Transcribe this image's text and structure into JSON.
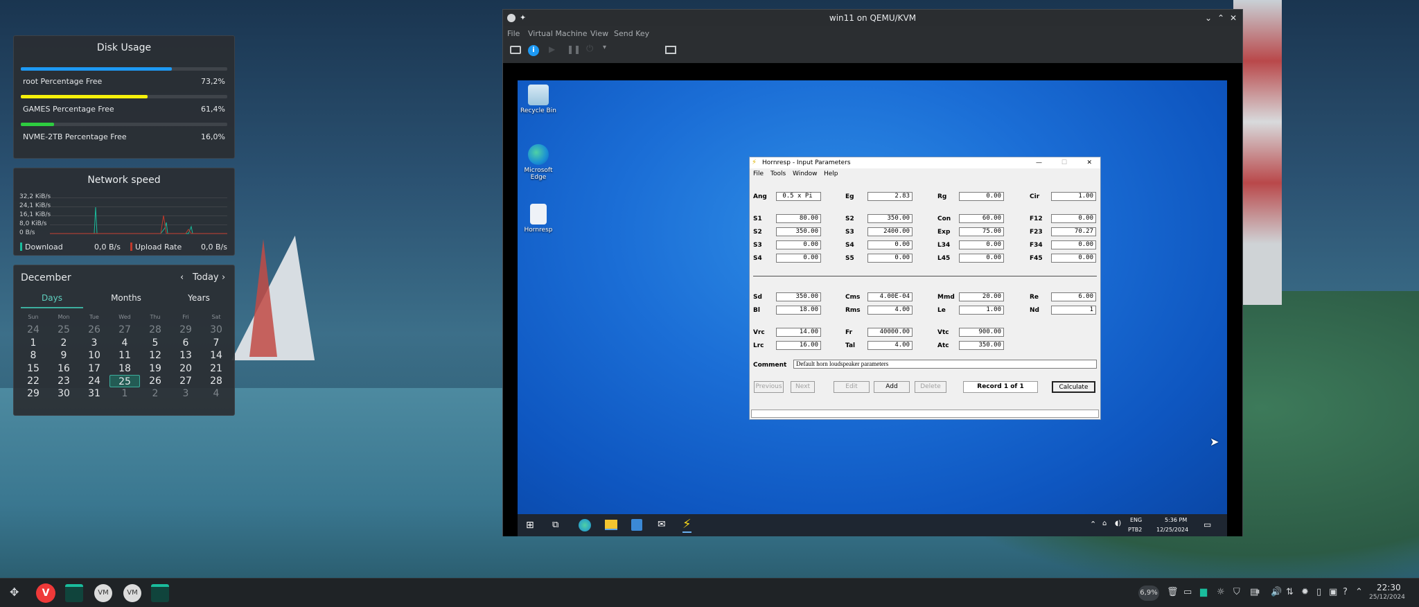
{
  "disk_usage": {
    "title": "Disk Usage",
    "items": [
      {
        "label": "root Percentage Free",
        "value": "73,2%",
        "fraction": 0.732,
        "color": "#1d99f3"
      },
      {
        "label": "GAMES Percentage Free",
        "value": "61,4%",
        "fraction": 0.614,
        "color": "#f6f10a"
      },
      {
        "label": "NVME-2TB Percentage Free",
        "value": "16,0%",
        "fraction": 0.16,
        "color": "#2ecc40"
      }
    ]
  },
  "network": {
    "title": "Network speed",
    "yticks": [
      "32,2 KiB/s",
      "24,1 KiB/s",
      "16,1 KiB/s",
      "8,0 KiB/s",
      "0 B/s"
    ],
    "download_label": "Download",
    "download_value": "0,0 B/s",
    "upload_label": "Upload Rate",
    "upload_value": "0,0 B/s",
    "download_color": "#1abc9c",
    "upload_color": "#c0392b"
  },
  "calendar": {
    "month": "December",
    "today_label": "Today",
    "tabs": [
      "Days",
      "Months",
      "Years"
    ],
    "weekdays": [
      "Sun",
      "Mon",
      "Tue",
      "Wed",
      "Thu",
      "Fri",
      "Sat"
    ],
    "days": [
      [
        "24",
        "25",
        "26",
        "27",
        "28",
        "29",
        "30"
      ],
      [
        "1",
        "2",
        "3",
        "4",
        "5",
        "6",
        "7"
      ],
      [
        "8",
        "9",
        "10",
        "11",
        "12",
        "13",
        "14"
      ],
      [
        "15",
        "16",
        "17",
        "18",
        "19",
        "20",
        "21"
      ],
      [
        "22",
        "23",
        "24",
        "25",
        "26",
        "27",
        "28"
      ],
      [
        "29",
        "30",
        "31",
        "1",
        "2",
        "3",
        "4"
      ]
    ]
  },
  "vm_window": {
    "title": "win11 on QEMU/KVM",
    "menu": [
      "File",
      "Virtual Machine",
      "View",
      "Send Key"
    ]
  },
  "desktop_icons": [
    "Recycle Bin",
    "Microsoft Edge",
    "Hornresp"
  ],
  "hornresp": {
    "title": "Hornresp - Input Parameters",
    "menu": [
      "File",
      "Tools",
      "Window",
      "Help"
    ],
    "row1": [
      {
        "label": "Ang",
        "value": "0.5 x Pi"
      },
      {
        "label": "Eg",
        "value": "2.83"
      },
      {
        "label": "Rg",
        "value": "0.00"
      },
      {
        "label": "Cir",
        "value": "1.00"
      }
    ],
    "rows_horn": [
      [
        {
          "label": "S1",
          "value": "80.00"
        },
        {
          "label": "S2",
          "value": "350.00"
        },
        {
          "label": "Con",
          "value": "60.00"
        },
        {
          "label": "F12",
          "value": "0.00"
        }
      ],
      [
        {
          "label": "S2",
          "value": "350.00"
        },
        {
          "label": "S3",
          "value": "2400.00"
        },
        {
          "label": "Exp",
          "value": "75.00"
        },
        {
          "label": "F23",
          "value": "70.27"
        }
      ],
      [
        {
          "label": "S3",
          "value": "0.00"
        },
        {
          "label": "S4",
          "value": "0.00"
        },
        {
          "label": "L34",
          "value": "0.00"
        },
        {
          "label": "F34",
          "value": "0.00"
        }
      ],
      [
        {
          "label": "S4",
          "value": "0.00"
        },
        {
          "label": "S5",
          "value": "0.00"
        },
        {
          "label": "L45",
          "value": "0.00"
        },
        {
          "label": "F45",
          "value": "0.00"
        }
      ]
    ],
    "rows_driver": [
      [
        {
          "label": "Sd",
          "value": "350.00"
        },
        {
          "label": "Cms",
          "value": "4.00E-04"
        },
        {
          "label": "Mmd",
          "value": "20.00"
        },
        {
          "label": "Re",
          "value": "6.00"
        }
      ],
      [
        {
          "label": "Bl",
          "value": "18.00"
        },
        {
          "label": "Rms",
          "value": "4.00"
        },
        {
          "label": "Le",
          "value": "1.00"
        },
        {
          "label": "Nd",
          "value": "1"
        }
      ]
    ],
    "rows_chamber": [
      [
        {
          "label": "Vrc",
          "value": "14.00"
        },
        {
          "label": "Fr",
          "value": "40000.00"
        },
        {
          "label": "Vtc",
          "value": "900.00"
        }
      ],
      [
        {
          "label": "Lrc",
          "value": "16.00"
        },
        {
          "label": "Tal",
          "value": "4.00"
        },
        {
          "label": "Atc",
          "value": "350.00"
        }
      ]
    ],
    "comment_label": "Comment",
    "comment_value": "Default horn loudspeaker parameters",
    "buttons": [
      "Previous",
      "Next",
      "Edit",
      "Add",
      "Delete"
    ],
    "record": "Record 1 of 1",
    "calculate": "Calculate"
  },
  "win_taskbar": {
    "lang1": "ENG",
    "lang2": "PTB2",
    "time": "5:36 PM",
    "date": "12/25/2024"
  },
  "panel": {
    "cpu": "6,9%",
    "time": "22:30",
    "date": "25/12/2024"
  }
}
